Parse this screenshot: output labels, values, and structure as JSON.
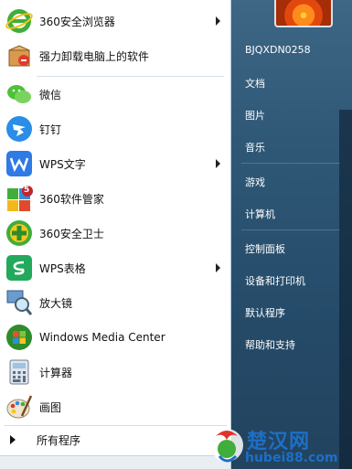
{
  "programs": [
    {
      "label": "360安全浏览器",
      "icon": "360-browser-icon",
      "arrow": true
    },
    {
      "label": "强力卸载电脑上的软件",
      "icon": "uninstaller-box-icon",
      "arrow": false
    },
    {
      "label": "微信",
      "icon": "wechat-icon",
      "arrow": false
    },
    {
      "label": "钉钉",
      "icon": "dingtalk-icon",
      "arrow": false
    },
    {
      "label": "WPS文字",
      "icon": "wps-writer-icon",
      "arrow": true
    },
    {
      "label": "360软件管家",
      "icon": "360-software-manager-icon",
      "arrow": false,
      "badge": "5"
    },
    {
      "label": "360安全卫士",
      "icon": "360-security-icon",
      "arrow": false
    },
    {
      "label": "WPS表格",
      "icon": "wps-spreadsheet-icon",
      "arrow": true
    },
    {
      "label": "放大镜",
      "icon": "magnifier-icon",
      "arrow": false
    },
    {
      "label": "Windows Media Center",
      "icon": "windows-media-center-icon",
      "arrow": false
    },
    {
      "label": "计算器",
      "icon": "calculator-icon",
      "arrow": false
    },
    {
      "label": "画图",
      "icon": "paint-icon",
      "arrow": false
    }
  ],
  "all_programs": "所有程序",
  "right_panel": {
    "username": "BJQXDN0258",
    "items": [
      "文档",
      "图片",
      "音乐",
      "游戏",
      "计算机",
      "控制面板",
      "设备和打印机",
      "默认程序",
      "帮助和支持"
    ]
  },
  "watermark": {
    "text": "楚汉网",
    "url": "hubei88.com"
  },
  "colors": {
    "right_panel": "#2f5877",
    "watermark": "#1c6fc8"
  }
}
